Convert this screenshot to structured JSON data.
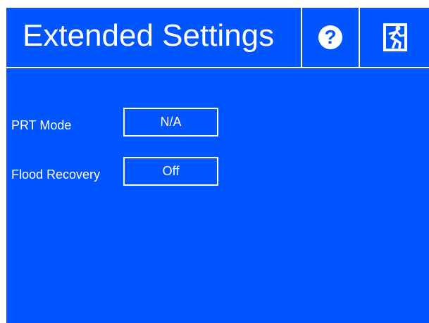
{
  "header": {
    "title": "Extended Settings",
    "help_icon": "question-mark-icon",
    "exit_icon": "running-man-exit-icon"
  },
  "settings": [
    {
      "label": "PRT Mode",
      "value": "N/A"
    },
    {
      "label": "Flood Recovery",
      "value": "Off"
    }
  ],
  "colors": {
    "background": "#0055ff",
    "foreground": "#ffffff"
  }
}
